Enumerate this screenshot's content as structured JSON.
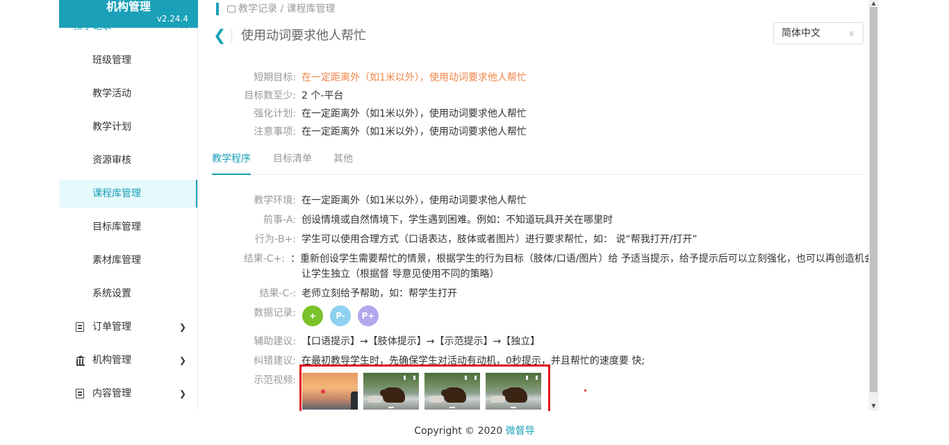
{
  "app": {
    "title": "机构管理",
    "version": "v2.24.4"
  },
  "sidebar": {
    "group_top": {
      "label": "教学记录"
    },
    "items": [
      {
        "label": "班级管理"
      },
      {
        "label": "教学活动"
      },
      {
        "label": "教学计划"
      },
      {
        "label": "资源审核"
      },
      {
        "label": "课程库管理"
      },
      {
        "label": "目标库管理"
      },
      {
        "label": "素材库管理"
      },
      {
        "label": "系统设置"
      }
    ],
    "groups": [
      {
        "label": "订单管理"
      },
      {
        "label": "机构管理"
      },
      {
        "label": "内容管理"
      }
    ]
  },
  "breadcrumb": "教学记录 / 课程库管理",
  "page_title": "使用动词要求他人帮忙",
  "language": {
    "selected": "简体中文"
  },
  "info": {
    "short_goal": {
      "label": "短期目标:",
      "value": "在一定距离外（如1米以外），使用动词要求他人帮忙"
    },
    "min_goals": {
      "label": "目标数至少:",
      "value": "2 个-平台"
    },
    "reinforcement": {
      "label": "强化计划:",
      "value": "在一定距离外（如1米以外），使用动词要求他人帮忙"
    },
    "notes": {
      "label": "注意事项:",
      "value": "在一定距离外（如1米以外），使用动词要求他人帮忙"
    }
  },
  "tabs": [
    {
      "label": "教学程序"
    },
    {
      "label": "目标清单"
    },
    {
      "label": "其他"
    }
  ],
  "procedure": {
    "env": {
      "label": "教学环境:",
      "value": "在一定距离外（如1米以外），使用动词要求他人帮忙"
    },
    "antecedent": {
      "label": "前事-A:",
      "value": "创设情境或自然情境下，学生遇到困难。例如：不知道玩具开关在哪里时"
    },
    "behavior": {
      "label": "行为-B+:",
      "value": "学生可以使用合理方式（口语表达，肢体或者图片）进行要求帮忙，如： 说“帮我打开/打开”"
    },
    "result_plus": {
      "label": "结果-C+:",
      "value_line1": "：重新创设学生需要帮忙的情景，根据学生的行为目标（肢体/口语/图片）给 予适当提示，给予提示后可以立刻强化，也可以再创造机会",
      "value_line2": "让学生独立（根据督 导意见使用不同的策略）"
    },
    "result_minus": {
      "label": "结果-C-:",
      "value": "老师立刻给予帮助，如：帮学生打开"
    },
    "data_record": {
      "label": "数据记录:",
      "plus": "+",
      "p_minus": "P-",
      "p_plus": "P+"
    },
    "assist": {
      "label": "辅助建议:",
      "value": "【口语提示】→【肢体提示】→【示范提示】→【独立】"
    },
    "correction": {
      "label": "纠错建议:",
      "value": "在最初教导学生时，先确保学生对活动有动机，0秒提示，并且帮忙的速度要 快;"
    },
    "demo_video": {
      "label": "示范视频:"
    }
  },
  "footer": {
    "copyright": "Copyright © 2020",
    "brand": "微督导"
  },
  "colors": {
    "accent": "#1aa0b8",
    "orange": "#f0864a",
    "green": "#7ac22a",
    "light_blue": "#8fd0f0",
    "lavender": "#b3a8ee",
    "highlight": "#e00d1a"
  }
}
